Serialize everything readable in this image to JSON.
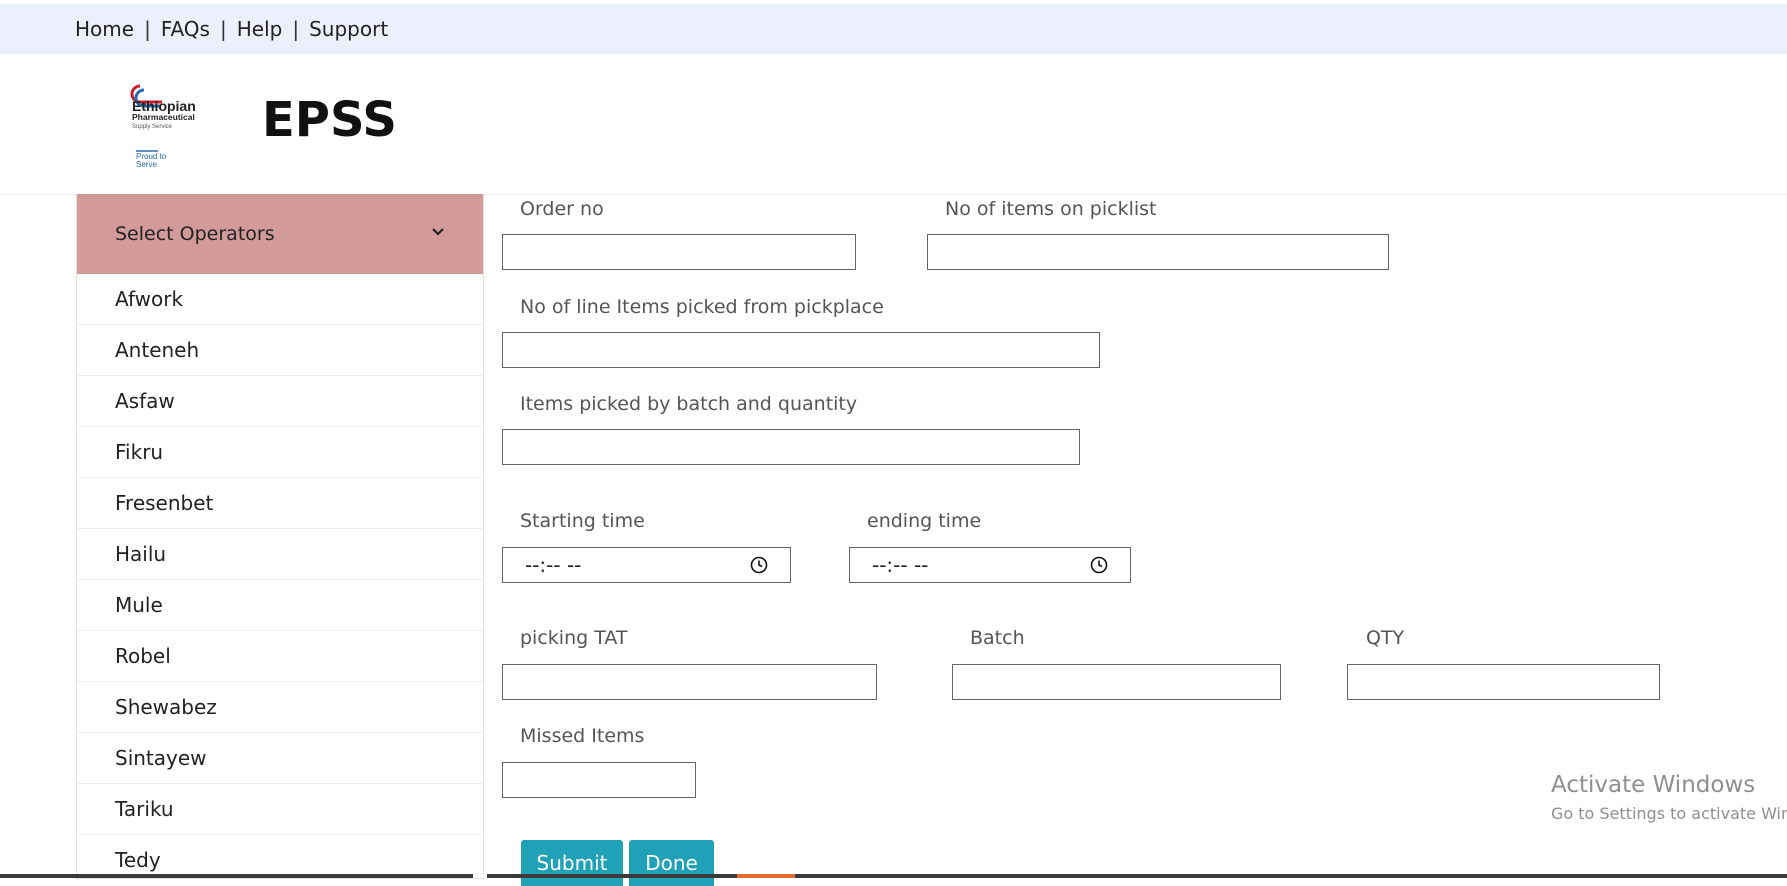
{
  "topnav": {
    "links": [
      "Home",
      "FAQs",
      "Help",
      "Support"
    ],
    "separator": "|"
  },
  "header": {
    "brand": "EPSS",
    "logo_text": [
      "Ethiopian",
      "Pharmaceutical",
      "Supply Service",
      "Proud to",
      "Serve"
    ]
  },
  "sidebar": {
    "title": "Select Operators",
    "chevron_icon": "chevron-down-icon",
    "operators": [
      "Afwork",
      "Anteneh",
      "Asfaw",
      "Fikru",
      "Fresenbet",
      "Hailu",
      "Mule",
      "Robel",
      "Shewabez",
      "Sintayew",
      "Tariku",
      "Tedy"
    ]
  },
  "form": {
    "order_no": {
      "label": "Order no",
      "value": ""
    },
    "items_on_picklist": {
      "label": "No of items on picklist",
      "value": ""
    },
    "line_items_picked": {
      "label": "No of line Items picked from pickplace",
      "value": ""
    },
    "items_by_batch": {
      "label": "Items picked by batch and quantity",
      "value": ""
    },
    "starting_time": {
      "label": "Starting time",
      "placeholder": "--:-- --",
      "icon": "clock-icon"
    },
    "ending_time": {
      "label": "ending time",
      "placeholder": "--:-- --",
      "icon": "clock-icon"
    },
    "picking_tat": {
      "label": "picking TAT",
      "value": ""
    },
    "batch": {
      "label": "Batch",
      "value": ""
    },
    "qty": {
      "label": "QTY",
      "value": ""
    },
    "missed_items": {
      "label": "Missed Items",
      "value": ""
    },
    "submit_label": "Submit",
    "done_label": "Done"
  },
  "watermark": {
    "line1": "Activate Windows",
    "line2": "Go to Settings to activate Windows."
  },
  "colors": {
    "topnav_bg": "#eceffc",
    "sidebar_header": "#d29b99",
    "button": "#21a1b8"
  }
}
